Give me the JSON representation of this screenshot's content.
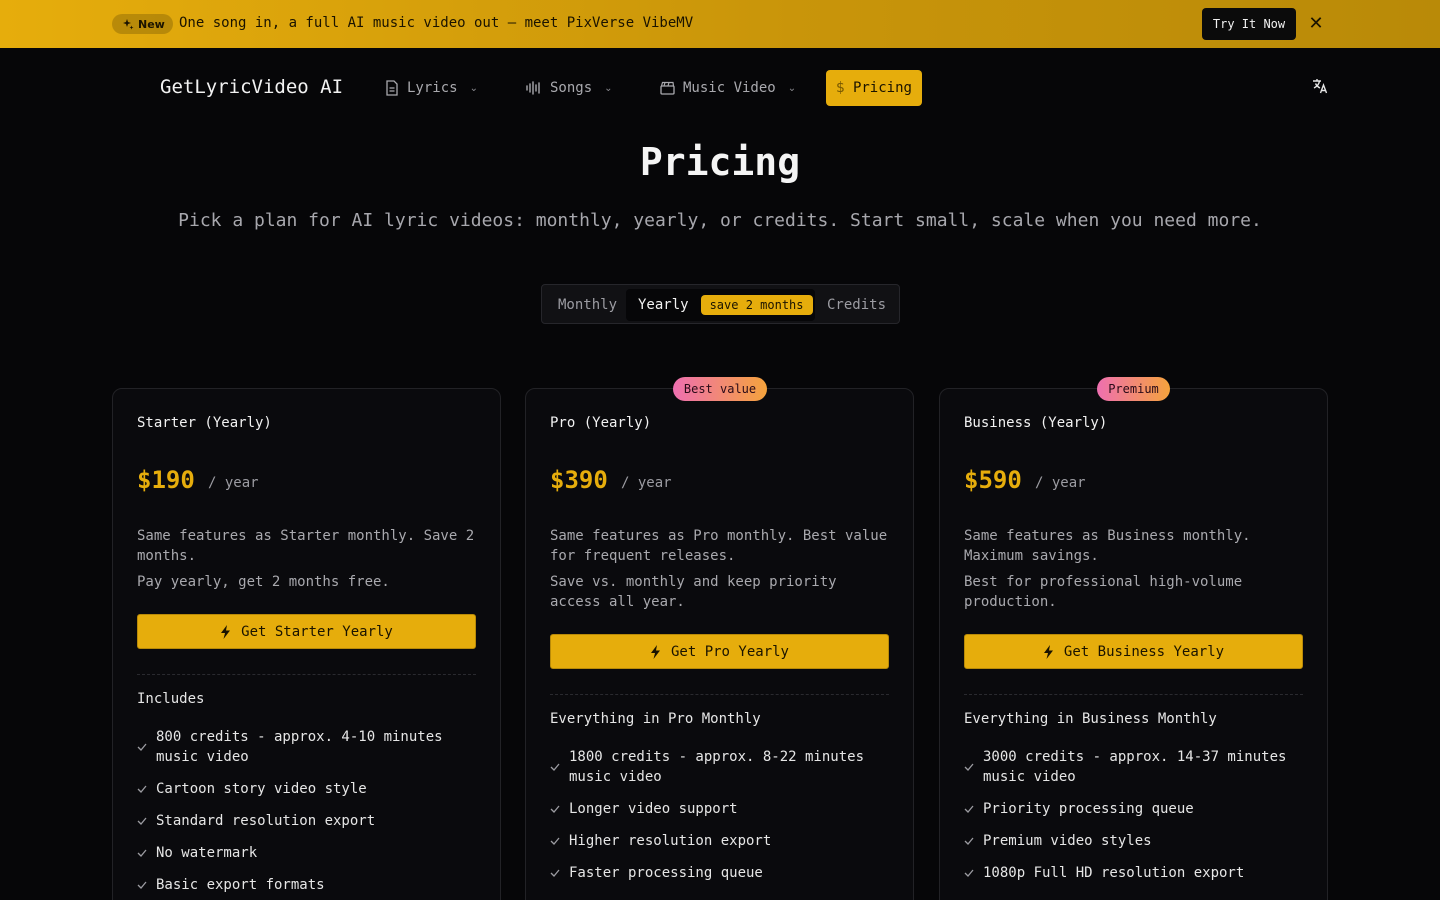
{
  "banner": {
    "badge": "New",
    "text": "One song in, a full AI music video out — meet PixVerse VibeMV",
    "cta": "Try It Now",
    "close": "✕"
  },
  "nav": {
    "logo": "GetLyricVideo AI",
    "items": [
      {
        "label": "Lyrics",
        "icon": "document-icon"
      },
      {
        "label": "Songs",
        "icon": "audio-wave-icon"
      },
      {
        "label": "Music Video",
        "icon": "clapperboard-icon"
      }
    ],
    "pricing": "Pricing"
  },
  "header": {
    "title": "Pricing",
    "subtitle": "Pick a plan for AI lyric videos: monthly, yearly, or credits. Start small, scale when you need more."
  },
  "toggle": {
    "monthly": "Monthly",
    "yearly": "Yearly",
    "save": "save 2 months",
    "credits": "Credits",
    "selected": "Yearly"
  },
  "colors": {
    "accent": "#e6ad0c",
    "background": "#060608",
    "ribbon_from": "#ee6fb0",
    "ribbon_to": "#f5a33c"
  },
  "plans": [
    {
      "ribbon": "",
      "name": "Starter (Yearly)",
      "price": "$190",
      "per": "/ year",
      "desc1": "Same features as Starter monthly. Save 2 months.",
      "desc2": "Pay yearly, get 2 months free.",
      "cta": "Get Starter Yearly",
      "includes_title": "Includes",
      "features": [
        "800 credits - approx. 4-10 minutes music video",
        "Cartoon story video style",
        "Standard resolution export",
        "No watermark",
        "Basic export formats"
      ]
    },
    {
      "ribbon": "Best value",
      "name": "Pro (Yearly)",
      "price": "$390",
      "per": "/ year",
      "desc1": "Same features as Pro monthly. Best value for frequent releases.",
      "desc2": "Save vs. monthly and keep priority access all year.",
      "cta": "Get Pro Yearly",
      "includes_title": "Everything in Pro Monthly",
      "features": [
        "1800 credits - approx. 8-22 minutes music video",
        "Longer video support",
        "Higher resolution export",
        "Faster processing queue"
      ]
    },
    {
      "ribbon": "Premium",
      "name": "Business (Yearly)",
      "price": "$590",
      "per": "/ year",
      "desc1": "Same features as Business monthly. Maximum savings.",
      "desc2": "Best for professional high-volume production.",
      "cta": "Get Business Yearly",
      "includes_title": "Everything in Business Monthly",
      "features": [
        "3000 credits - approx. 14-37 minutes music video",
        "Priority processing queue",
        "Premium video styles",
        "1080p Full HD resolution export"
      ]
    }
  ]
}
